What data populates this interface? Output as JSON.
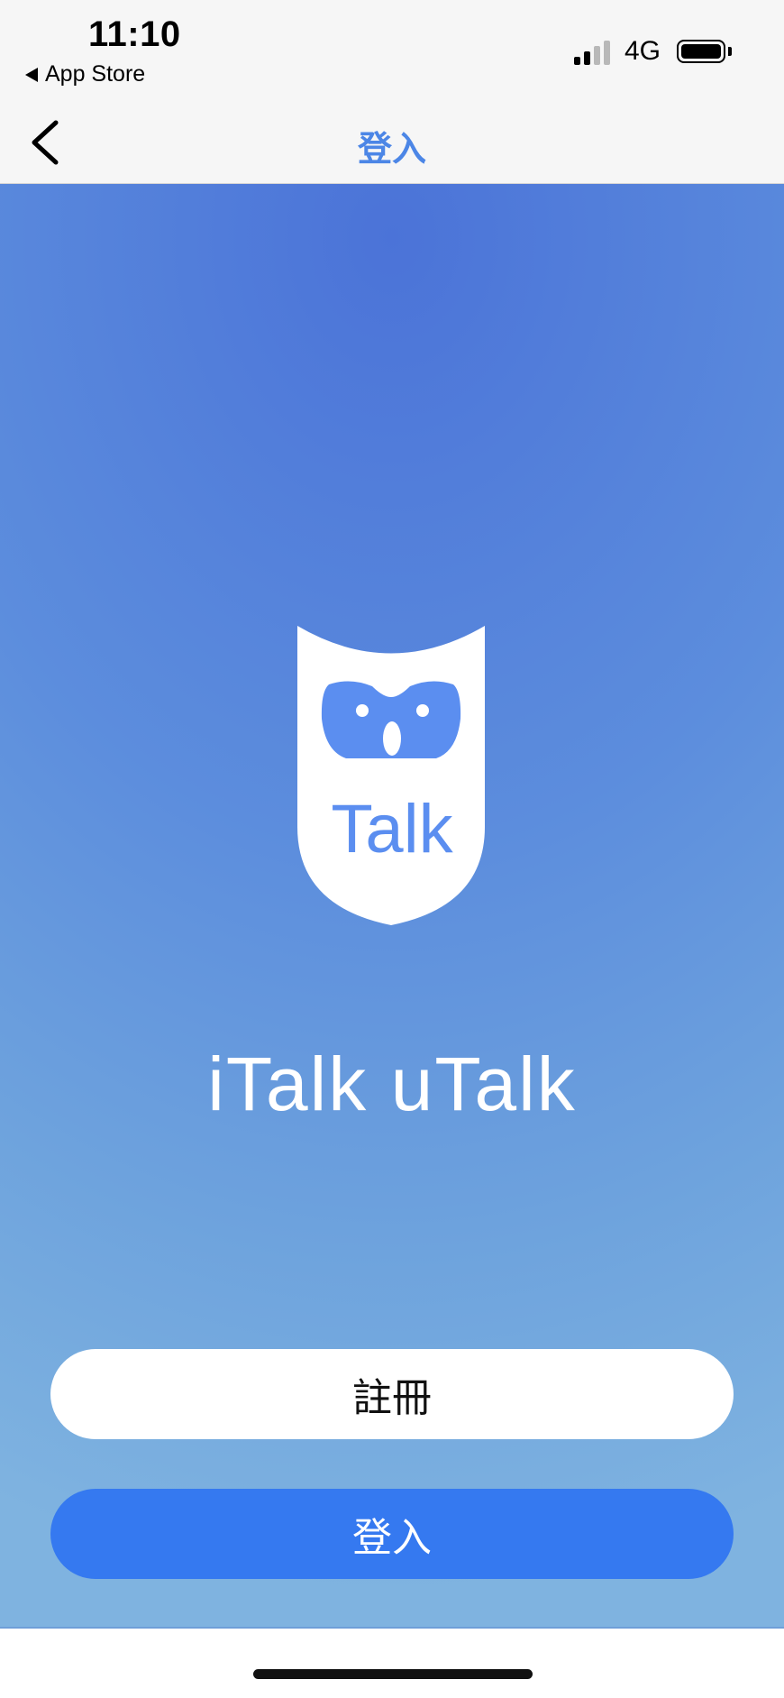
{
  "status_bar": {
    "time": "11:10",
    "back_app": "App Store",
    "network": "4G"
  },
  "nav": {
    "title": "登入"
  },
  "hero": {
    "logo_text": "Talk",
    "app_name": "iTalk uTalk"
  },
  "actions": {
    "register_label": "註冊",
    "login_label": "登入"
  },
  "colors": {
    "accent": "#3579f0",
    "nav_title": "#4c86e6",
    "logo_face": "#5b8ef0"
  },
  "icons": {
    "nav_back": "chevron-left-icon",
    "logo": "owl-shield-logo"
  }
}
